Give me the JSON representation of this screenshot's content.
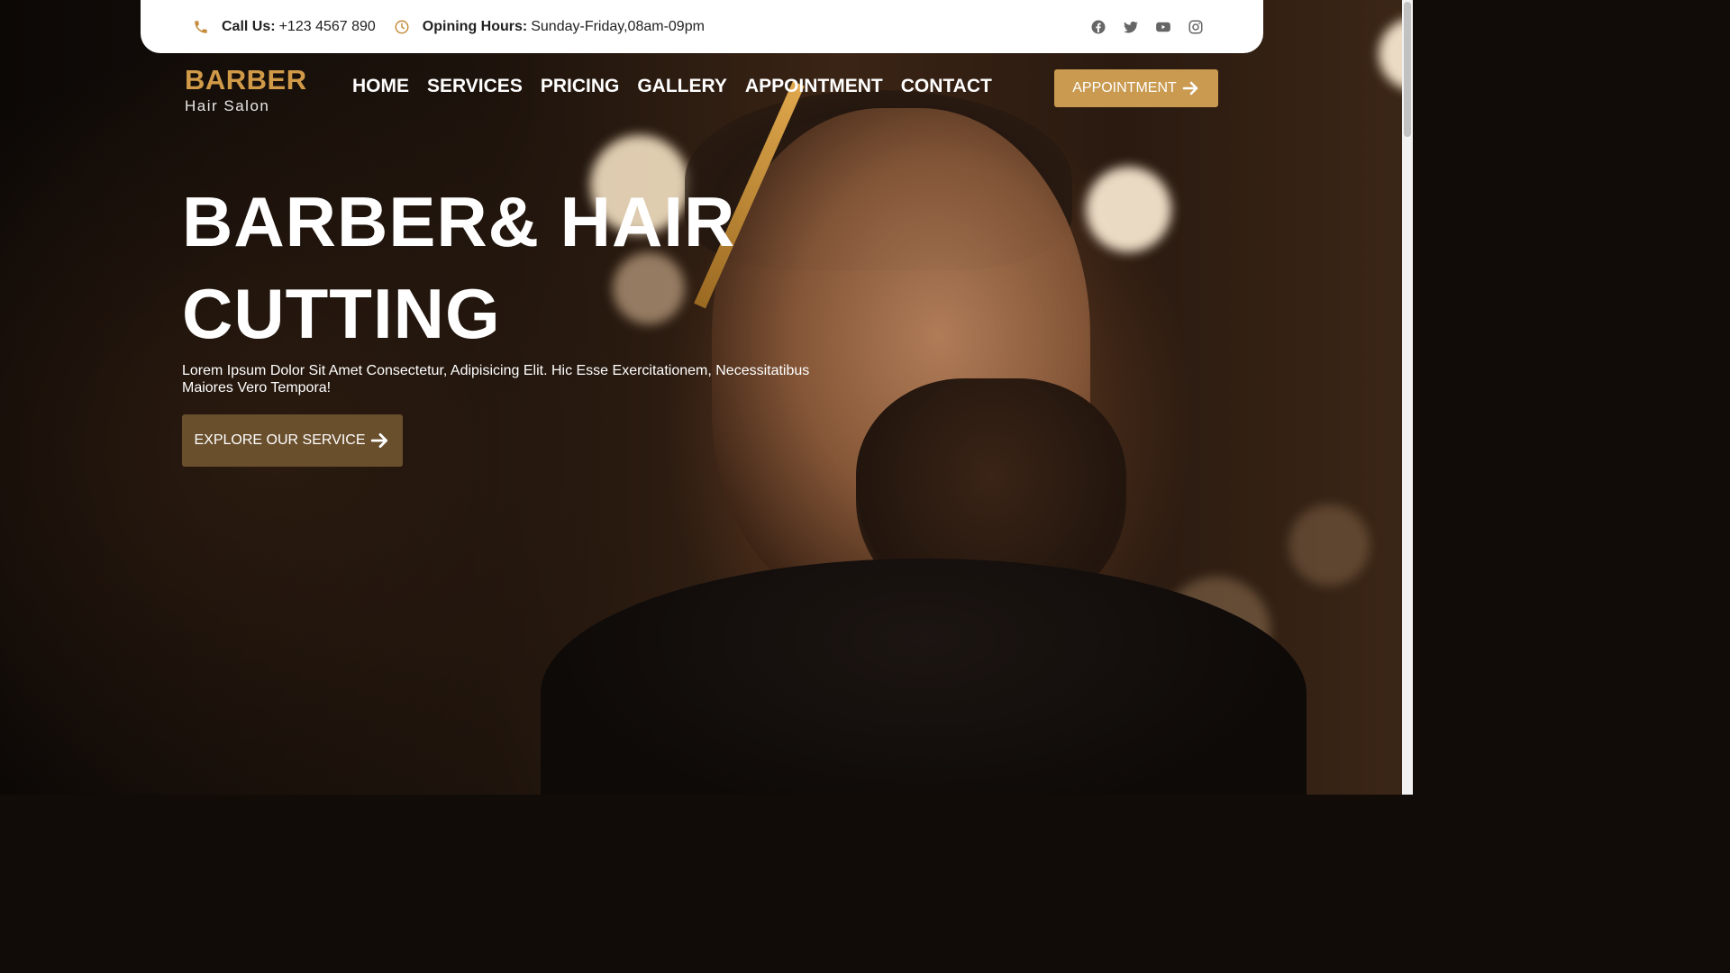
{
  "topbar": {
    "call_label": "Call Us:",
    "call_value": "+123 4567 890",
    "hours_label": "Opining Hours:",
    "hours_value": "Sunday-Friday,08am-09pm",
    "icons": [
      "phone-icon",
      "clock-icon",
      "facebook-icon",
      "twitter-icon",
      "youtube-icon",
      "instagram-icon"
    ]
  },
  "logo": {
    "title": "BARBER",
    "subtitle": "Hair Salon"
  },
  "nav": {
    "items": [
      "HOME",
      "SERVICES",
      "PRICING",
      "GALLERY",
      "APPOINTMENT",
      "CONTACT"
    ],
    "cta_label": "APPOINTMENT"
  },
  "hero": {
    "title_line1": "BARBER& HAIR",
    "title_line2": "CUTTING",
    "description": "Lorem Ipsum Dolor Sit Amet Consectetur, Adipisicing Elit. Hic Esse Exercitationem, Necessitatibus Maiores Vero Tempora!",
    "button_label": "EXPLORE OUR SERVICE"
  },
  "colors": {
    "accent": "#c99a4f",
    "logo_gold": "#d19a48",
    "button_dark": "#6a4f2d",
    "topbar_bg": "#ffffff"
  }
}
